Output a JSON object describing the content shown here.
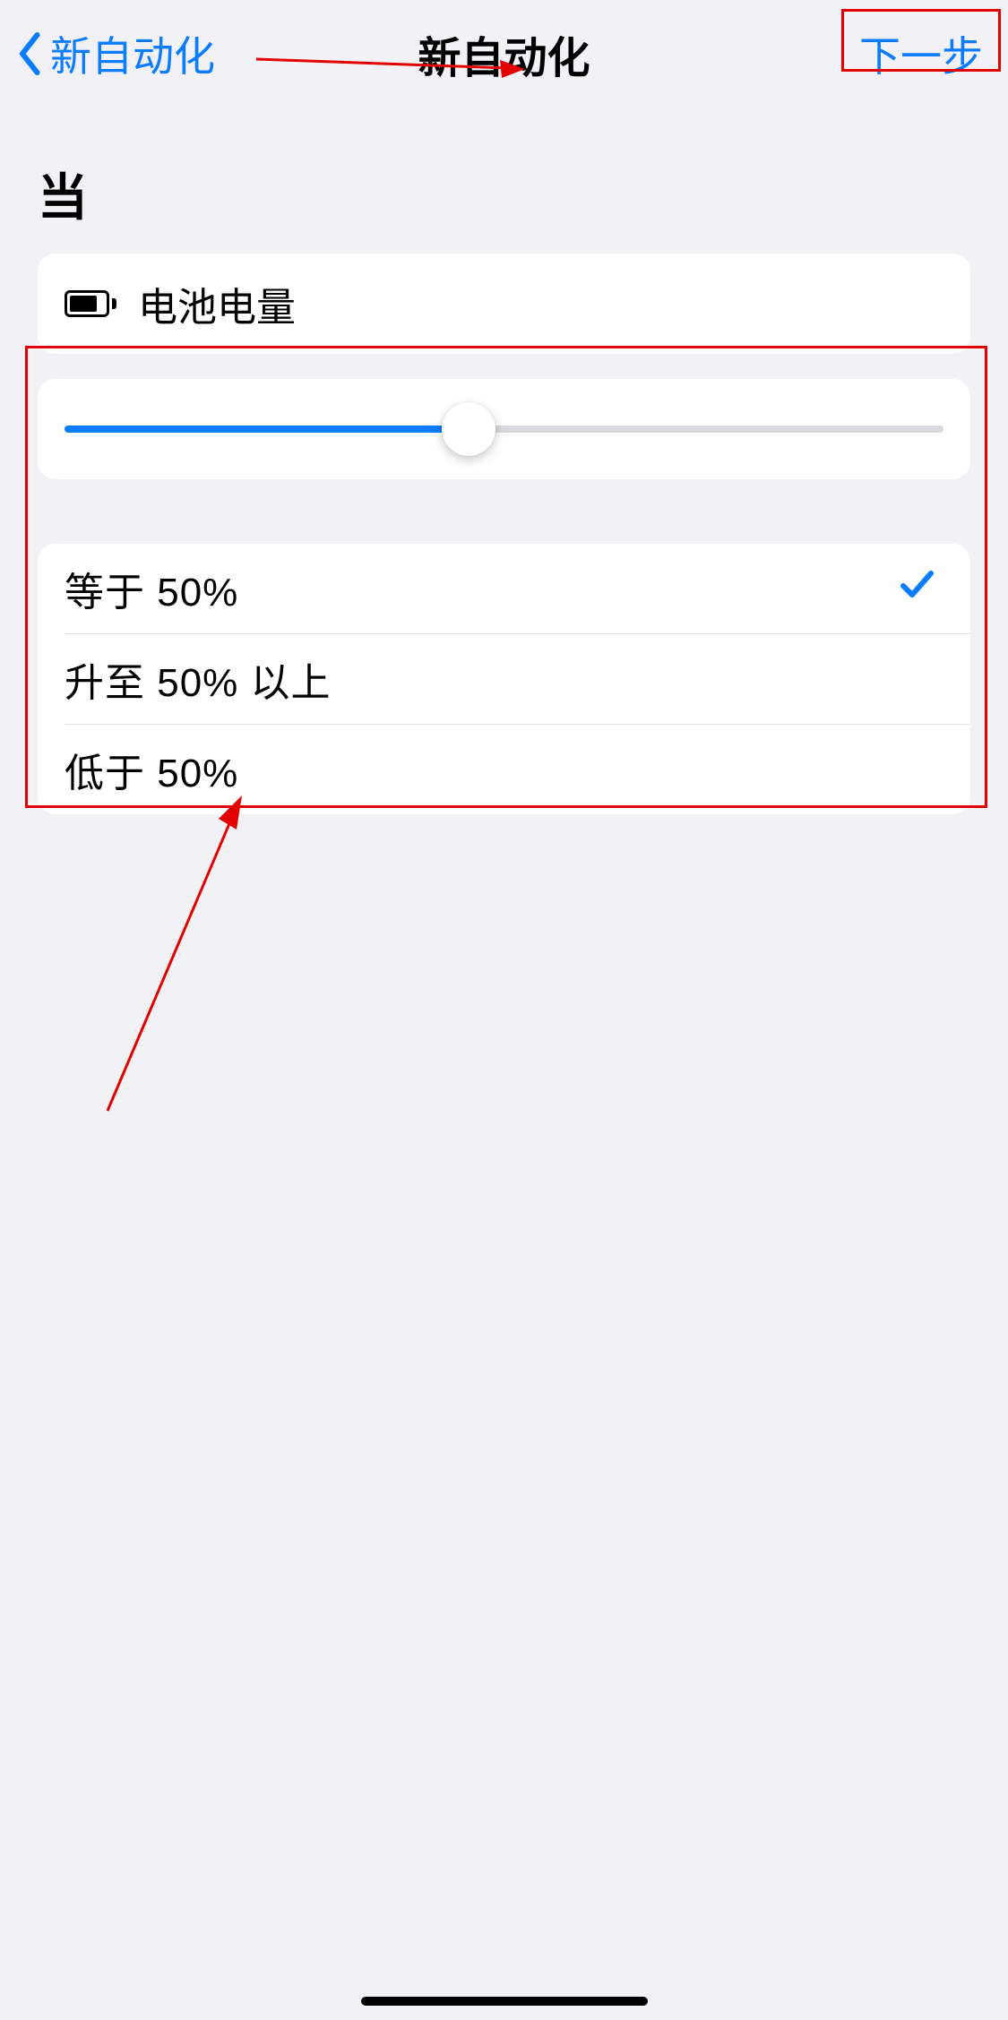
{
  "nav": {
    "back_label": "新自动化",
    "title": "新自动化",
    "next_label": "下一步"
  },
  "section_header": "当",
  "trigger": {
    "label": "电池电量"
  },
  "slider": {
    "percent": 46
  },
  "options": [
    {
      "label": "等于 50%",
      "selected": true
    },
    {
      "label": "升至 50% 以上",
      "selected": false
    },
    {
      "label": "低于 50%",
      "selected": false
    }
  ]
}
